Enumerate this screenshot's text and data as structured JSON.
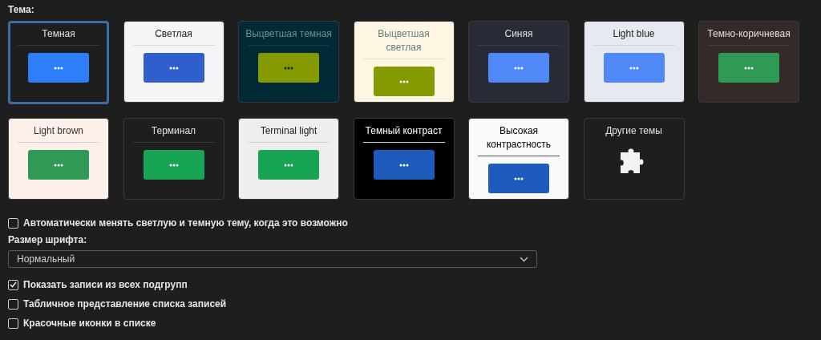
{
  "theme_label": "Тема:",
  "themes": [
    {
      "kind": "dark",
      "label": "Темная",
      "selected": true,
      "color": "#2d7ff9"
    },
    {
      "kind": "light",
      "label": "Светлая",
      "selected": false,
      "color": "#2e5fcc"
    },
    {
      "kind": "fadeddark",
      "label": "Выцветшая темная",
      "selected": false,
      "color": "#859900"
    },
    {
      "kind": "fadedlight",
      "label": "Выцветшая светлая",
      "selected": false,
      "color": "#859900"
    },
    {
      "kind": "blue",
      "label": "Синяя",
      "selected": false,
      "color": "#5188f7"
    },
    {
      "kind": "lightblue",
      "label": "Light blue",
      "selected": false,
      "color": "#5188f7"
    },
    {
      "kind": "darkbrown",
      "label": "Темно-коричневая",
      "selected": false,
      "color": "#2e9a55"
    },
    {
      "kind": "lightbrown",
      "label": "Light brown",
      "selected": false,
      "color": "#2e9a55"
    },
    {
      "kind": "terminal",
      "label": "Терминал",
      "selected": false,
      "color": "#17a555"
    },
    {
      "kind": "terminallight",
      "label": "Terminal light",
      "selected": false,
      "color": "#17a555"
    },
    {
      "kind": "darkcontrast",
      "label": "Темный контраст",
      "selected": false,
      "color": "#1f5bbd"
    },
    {
      "kind": "highcontrast",
      "label": "Высокая контрастность",
      "selected": false,
      "color": "#1f5bbd"
    },
    {
      "kind": "more",
      "label": "Другие темы",
      "selected": false
    }
  ],
  "auto_switch": {
    "label": "Автоматически менять светлую и темную тему, когда это возможно",
    "checked": false
  },
  "font_size": {
    "label": "Размер шрифта:",
    "value": "Нормальный"
  },
  "options": [
    {
      "label": "Показать записи из всех подгрупп",
      "checked": true
    },
    {
      "label": "Табличное представление списка записей",
      "checked": false
    },
    {
      "label": "Красочные иконки в списке",
      "checked": false
    }
  ]
}
